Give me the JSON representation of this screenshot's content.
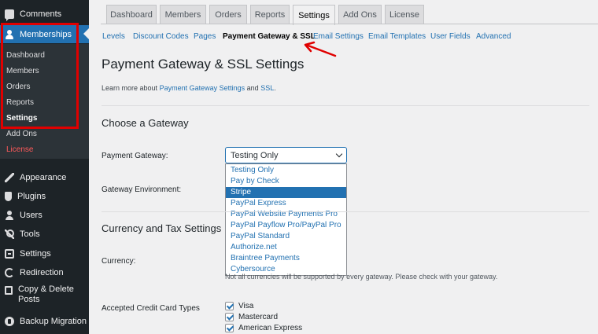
{
  "sidebar": {
    "comments": "Comments",
    "memberships": "Memberships",
    "submenu": [
      "Dashboard",
      "Members",
      "Orders",
      "Reports",
      "Settings",
      "Add Ons",
      "License"
    ],
    "bottom": [
      "Appearance",
      "Plugins",
      "Users",
      "Tools",
      "Settings",
      "Redirection",
      "Copy & Delete",
      "Posts",
      "Backup Migration"
    ]
  },
  "tabs": [
    "Dashboard",
    "Members",
    "Orders",
    "Reports",
    "Settings",
    "Add Ons",
    "License"
  ],
  "subnav": [
    "Levels",
    "Discount Codes",
    "Pages",
    "Payment Gateway & SSL",
    "Email Settings",
    "Email Templates",
    "User Fields",
    "Advanced"
  ],
  "page": {
    "title": "Payment Gateway & SSL Settings",
    "learn_prefix": "Learn more about",
    "learn_link1": "Payment Gateway Settings",
    "learn_and": "and",
    "learn_link2": "SSL",
    "learn_suffix": "."
  },
  "gateway_section": {
    "heading": "Choose a Gateway",
    "payment_gateway_label": "Payment Gateway:",
    "gateway_env_label": "Gateway Environment:",
    "selected": "Testing Only",
    "options": [
      "Testing Only",
      "Pay by Check",
      "Stripe",
      "PayPal Express",
      "PayPal Website Payments Pro",
      "PayPal Payflow Pro/PayPal Pro",
      "PayPal Standard",
      "Authorize.net",
      "Braintree Payments",
      "Cybersource"
    ],
    "highlighted_index": 2
  },
  "currency_section": {
    "heading": "Currency and Tax Settings",
    "currency_label": "Currency:",
    "note": "Not all currencies will be supported by every gateway. Please check with your gateway.",
    "cc_label": "Accepted Credit Card Types",
    "cards": [
      "Visa",
      "Mastercard",
      "American Express"
    ]
  },
  "colors": {
    "accent": "#2271b1",
    "annotation_red": "#e00000",
    "sidebar_bg": "#1d2327"
  }
}
